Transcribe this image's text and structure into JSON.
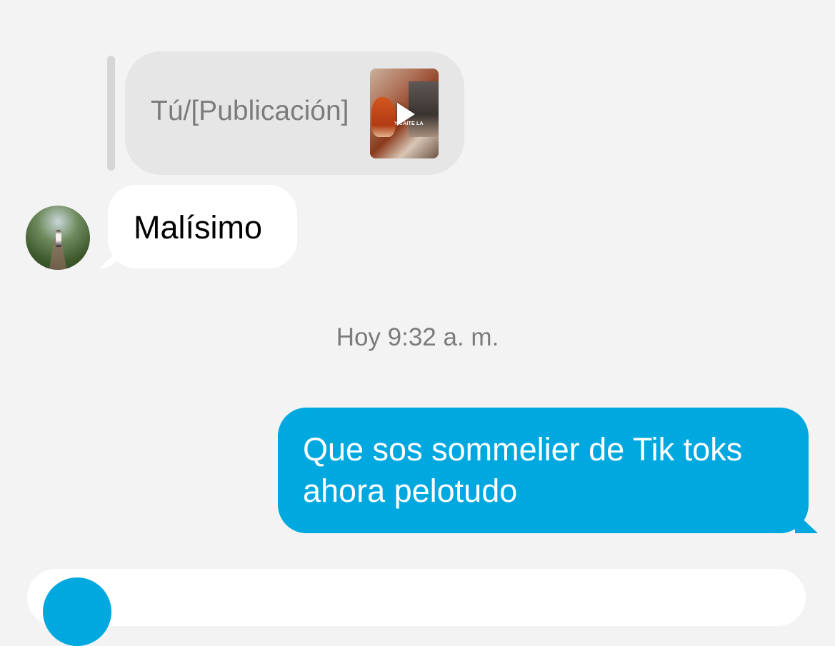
{
  "reply": {
    "label": "Tú/[Publicación]",
    "thumbnail_caption": "Y CAITE LA",
    "play_icon": "play-icon"
  },
  "incoming_message": {
    "text": "Malísimo",
    "avatar_icon": "avatar-photo"
  },
  "timestamp": "Hoy 9:32 a. m.",
  "outgoing_message": {
    "text": "Que sos sommelier de Tik toks ahora pelotudo"
  },
  "composer": {
    "camera_icon": "camera-icon"
  },
  "colors": {
    "background": "#f3f3f3",
    "outgoing_bubble": "#00a8e0",
    "incoming_bubble": "#ffffff",
    "reply_bubble": "#e6e6e6",
    "muted_text": "#7b7b7b"
  }
}
